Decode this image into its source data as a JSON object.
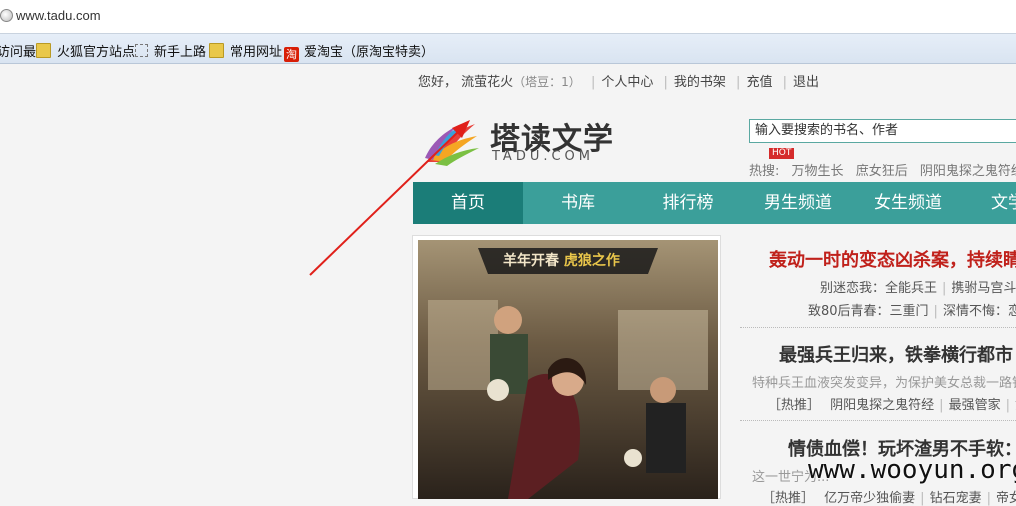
{
  "browser": {
    "url": "www.tadu.com",
    "bookmarks": [
      "访问最多",
      "火狐官方站点",
      "新手上路",
      "常用网址",
      "爱淘宝（原淘宝特卖）"
    ],
    "taobao_glyph": "淘"
  },
  "userbar": {
    "greeting": "您好，",
    "username": "流萤花火",
    "points": "（塔豆：1）",
    "links": [
      "个人中心",
      "我的书架",
      "充值",
      "退出"
    ]
  },
  "logo": {
    "cn": "塔读文学",
    "en": "TADU.COM"
  },
  "search": {
    "placeholder": "输入要搜索的书名、作者",
    "hot_badge": "HOT",
    "hot_label": "热搜:",
    "hot_keywords": [
      "万物生长",
      "庶女狂后",
      "阴阳鬼探之鬼符经"
    ]
  },
  "nav": {
    "items": [
      "首页",
      "书库",
      "排行榜",
      "男生频道",
      "女生频道",
      "文学"
    ],
    "active": 0
  },
  "cover": {
    "banner": "羊年开春",
    "banner2": "虎狼之作"
  },
  "articles": [
    {
      "title": "轰动一时的变态凶杀案，持续睛",
      "title_color": "#c0211b",
      "lines": [
        [
          "别迷恋我：全能兵王",
          "携驸马宫斗："
        ],
        [
          "致80后青春：三重门",
          "深情不悔：恋恋"
        ]
      ]
    },
    {
      "title": "最强兵王归来，铁拳横行都市",
      "title_color": "#222222",
      "lines": [
        [
          "特种兵王血液突发变异，为保护美女总裁一路铁血"
        ],
        [
          "［热推］",
          "阴阳鬼探之鬼符经",
          "最强管家",
          "黄金"
        ]
      ]
    },
    {
      "title": "情债血偿！玩坏渣男不手软：",
      "title_color": "#222222",
      "lines": [
        [
          "这一世宁为..."
        ],
        [
          "［热推］",
          "亿万帝少独偷妻",
          "钻石宠妻",
          "帝女毒"
        ]
      ]
    }
  ],
  "watermark": "www.wooyun.org"
}
